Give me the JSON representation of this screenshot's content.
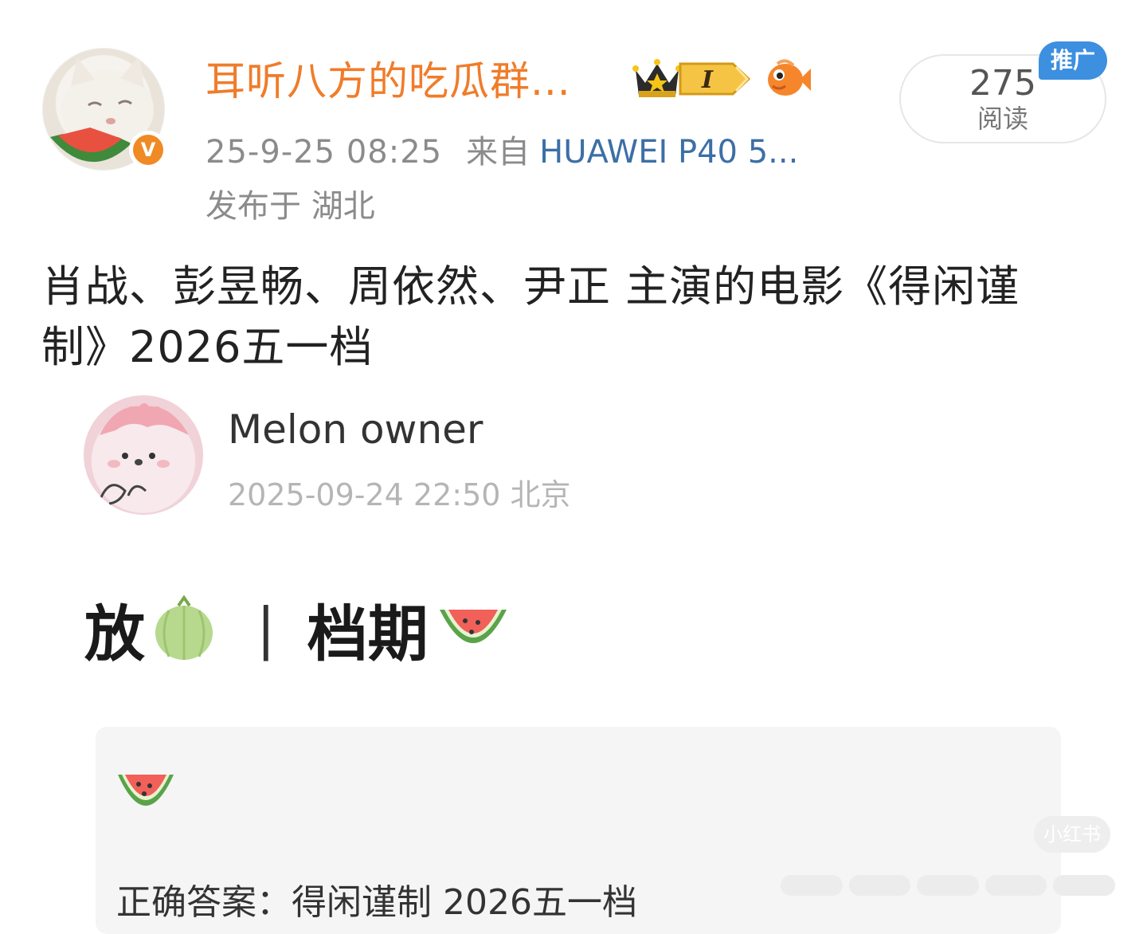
{
  "post": {
    "author": {
      "name": "耳听八方的吃瓜群...",
      "verified_mark": "V",
      "level_label": "I"
    },
    "meta": {
      "time": "25-9-25 08:25",
      "from_label": "来自",
      "device": "HUAWEI P40 5...",
      "location": "发布于 湖北"
    },
    "read_count": "275",
    "read_label": "阅读",
    "promo_tag": "推广",
    "text": "肖战、彭昱畅、周依然、尹正 主演的电影《得闲谨制》2026五一档",
    "icons": [
      "avatar",
      "verified-icon",
      "crown-badge-icon",
      "level-badge-icon",
      "fish-badge-icon"
    ]
  },
  "embedded": {
    "name": "Melon owner",
    "meta": "2025-09-24 22:50 北京",
    "heading_left": "放",
    "heading_sep": "|",
    "heading_right": "档期",
    "answer": "正确答案：得闲谨制 2026五一档",
    "watermark": "小红书",
    "icons": [
      "melon-icon",
      "watermelon-icon"
    ]
  },
  "colors": {
    "username": "#f07c2a",
    "device_link": "#3c6fa6",
    "promo": "#3d8fe0",
    "meta_gray": "#8b8b8b"
  }
}
